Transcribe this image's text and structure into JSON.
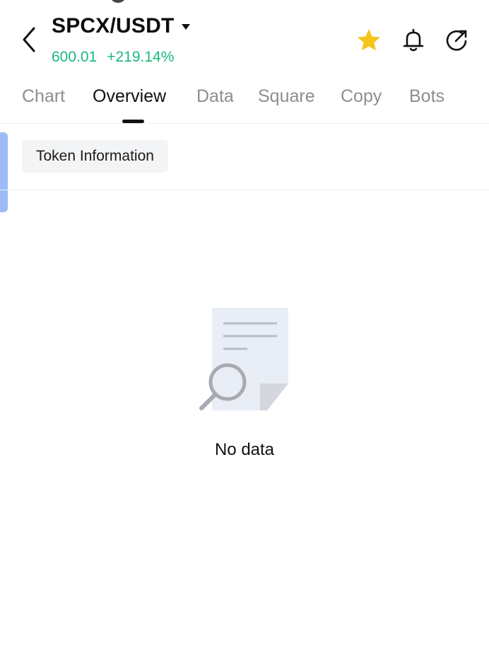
{
  "header": {
    "pair": "SPCX/USDT",
    "price": "600.01",
    "change": "+219.14%"
  },
  "tabs": [
    {
      "label": "Chart"
    },
    {
      "label": "Overview"
    },
    {
      "label": "Data"
    },
    {
      "label": "Square"
    },
    {
      "label": "Copy"
    },
    {
      "label": "Bots"
    }
  ],
  "active_tab": "Overview",
  "subtab": {
    "label": "Token Information"
  },
  "empty_state": {
    "text": "No data",
    "icon": "no-data-document-search-icon"
  },
  "icons": {
    "back": "chevron-left-icon",
    "caret": "caret-down-icon",
    "favorite": "star-icon",
    "alert": "bell-icon",
    "share": "share-icon"
  },
  "colors": {
    "positive": "#19b87a",
    "favorite": "#f5c518",
    "accent": "#9bbcf7"
  }
}
